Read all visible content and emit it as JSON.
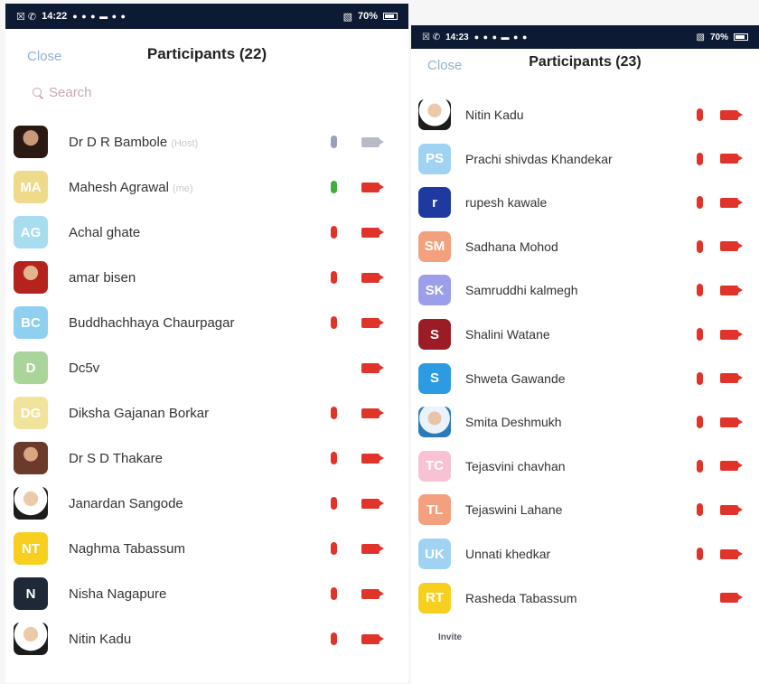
{
  "left": {
    "status": {
      "time": "14:22",
      "carrier": "☒ ✆",
      "battery": "70%"
    },
    "close_label": "Close",
    "title": "Participants (22)",
    "search_placeholder": "Search",
    "participants": [
      {
        "name": "Dr D R Bambole",
        "tag": "(Host)",
        "avatar": "photo",
        "initials": "",
        "color": "#2b1a14",
        "mic": "gray",
        "cam": "gray"
      },
      {
        "name": "Mahesh Agrawal",
        "tag": "(me)",
        "avatar": "initials",
        "initials": "MA",
        "color": "#efd98a",
        "mic": "green",
        "cam": "off"
      },
      {
        "name": "Achal ghate",
        "tag": "",
        "avatar": "initials",
        "initials": "AG",
        "color": "#a8dcef",
        "mic": "muted",
        "cam": "off"
      },
      {
        "name": "amar bisen",
        "tag": "",
        "avatar": "photo2",
        "initials": "",
        "color": "#b5231d",
        "mic": "muted",
        "cam": "off"
      },
      {
        "name": "Buddhachhaya Chaurpagar",
        "tag": "",
        "avatar": "initials",
        "initials": "BC",
        "color": "#8fd0f0",
        "mic": "muted",
        "cam": "off"
      },
      {
        "name": "Dc5v",
        "tag": "",
        "avatar": "initials",
        "initials": "D",
        "color": "#a9d49a",
        "mic": "",
        "cam": "off"
      },
      {
        "name": "Diksha Gajanan Borkar",
        "tag": "",
        "avatar": "initials",
        "initials": "DG",
        "color": "#f1e39b",
        "mic": "muted",
        "cam": "off"
      },
      {
        "name": "Dr S D  Thakare",
        "tag": "",
        "avatar": "photo3",
        "initials": "",
        "color": "#6b3a2a",
        "mic": "muted",
        "cam": "off"
      },
      {
        "name": "Janardan Sangode",
        "tag": "",
        "avatar": "photo4",
        "initials": "",
        "color": "#1c1c1c",
        "mic": "muted",
        "cam": "off"
      },
      {
        "name": "Naghma Tabassum",
        "tag": "",
        "avatar": "initials",
        "initials": "NT",
        "color": "#f7cf1e",
        "mic": "muted",
        "cam": "off"
      },
      {
        "name": "Nisha Nagapure",
        "tag": "",
        "avatar": "initials",
        "initials": "N",
        "color": "#1e2836",
        "mic": "muted",
        "cam": "off"
      },
      {
        "name": "Nitin Kadu",
        "tag": "",
        "avatar": "photo4",
        "initials": "",
        "color": "#1c1c1c",
        "mic": "muted",
        "cam": "off"
      }
    ]
  },
  "right": {
    "status": {
      "time": "14:23",
      "carrier": "☒ ✆",
      "battery": "70%"
    },
    "close_label": "Close",
    "title": "Participants (23)",
    "invite_label": "Invite",
    "participants": [
      {
        "name": "Nitin Kadu",
        "avatar": "photo4",
        "initials": "",
        "color": "#1c1c1c",
        "mic": "muted",
        "cam": "off"
      },
      {
        "name": "Prachi shivdas Khandekar",
        "avatar": "initials",
        "initials": "PS",
        "color": "#9fd3f1",
        "mic": "muted",
        "cam": "off"
      },
      {
        "name": "rupesh kawale",
        "avatar": "initials",
        "initials": "r",
        "color": "#1e3aa0",
        "mic": "muted",
        "cam": "off"
      },
      {
        "name": "Sadhana Mohod",
        "avatar": "initials",
        "initials": "SM",
        "color": "#f2a07d",
        "mic": "muted",
        "cam": "off"
      },
      {
        "name": "Samruddhi kalmegh",
        "avatar": "initials",
        "initials": "SK",
        "color": "#9b9ee8",
        "mic": "muted",
        "cam": "off"
      },
      {
        "name": "Shalini Watane",
        "avatar": "initials",
        "initials": "S",
        "color": "#9c1c26",
        "mic": "muted",
        "cam": "off"
      },
      {
        "name": "Shweta Gawande",
        "avatar": "initials",
        "initials": "S",
        "color": "#2d9be3",
        "mic": "muted",
        "cam": "off"
      },
      {
        "name": "Smita Deshmukh",
        "avatar": "photo5",
        "initials": "",
        "color": "#2c7ab8",
        "mic": "muted",
        "cam": "off"
      },
      {
        "name": "Tejasvini chavhan",
        "avatar": "initials",
        "initials": "TC",
        "color": "#f7c3d4",
        "mic": "muted",
        "cam": "off"
      },
      {
        "name": "Tejaswini Lahane",
        "avatar": "initials",
        "initials": "TL",
        "color": "#f2a07d",
        "mic": "muted",
        "cam": "off"
      },
      {
        "name": "Unnati khedkar",
        "avatar": "initials",
        "initials": "UK",
        "color": "#9fd3f1",
        "mic": "muted",
        "cam": "off"
      },
      {
        "name": "Rasheda Tabassum",
        "avatar": "initials",
        "initials": "RT",
        "color": "#f7cf1e",
        "mic": "",
        "cam": "off"
      }
    ]
  }
}
